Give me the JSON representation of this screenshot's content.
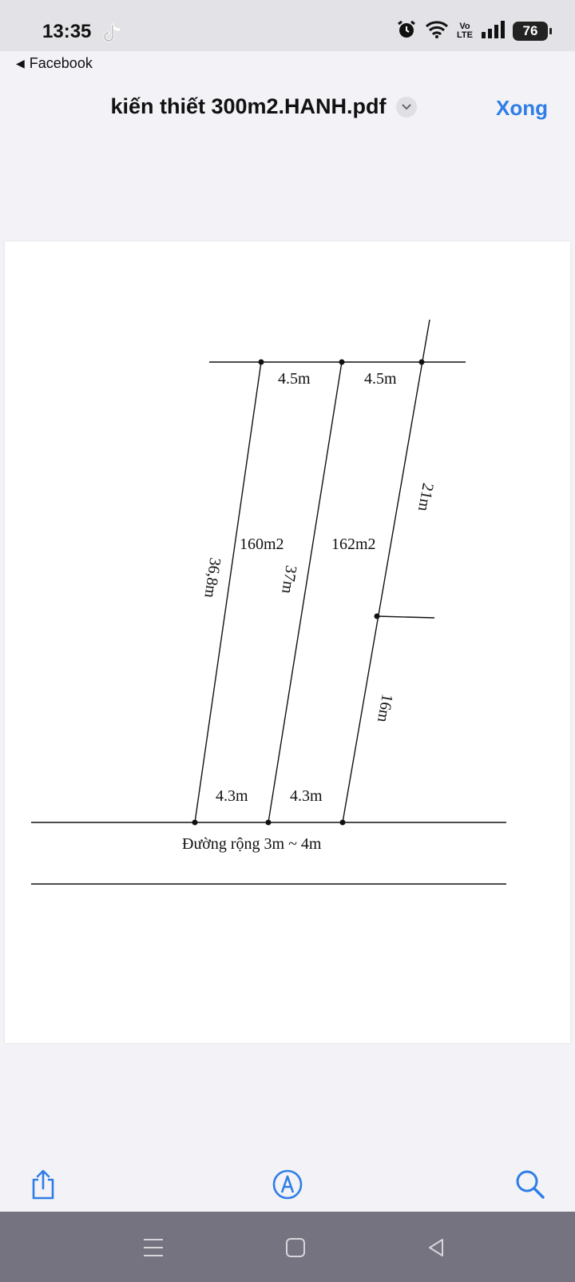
{
  "status_bar": {
    "time": "13:35",
    "volte_top": "Vo",
    "volte_bottom": "LTE",
    "battery": "76"
  },
  "back_link": {
    "label": "Facebook"
  },
  "header": {
    "title": "kiến thiết 300m2.HANH.pdf",
    "done_label": "Xong",
    "accent_color": "#2f7ee6"
  },
  "plan": {
    "top_widths": [
      "4.5m",
      "4.5m"
    ],
    "bottom_widths": [
      "4.3m",
      "4.3m"
    ],
    "areas": [
      "160m2",
      "162m2"
    ],
    "side_lengths": {
      "left": "36,8m",
      "middle": "37m",
      "right_upper": "21m",
      "right_lower": "16m"
    },
    "road_label": "Đường rộng 3m ~ 4m"
  },
  "toolbar": {
    "icons": [
      "share-icon",
      "markup-icon",
      "search-icon"
    ]
  },
  "navbar": {
    "icons": [
      "menu-icon",
      "home-icon",
      "back-icon"
    ]
  }
}
